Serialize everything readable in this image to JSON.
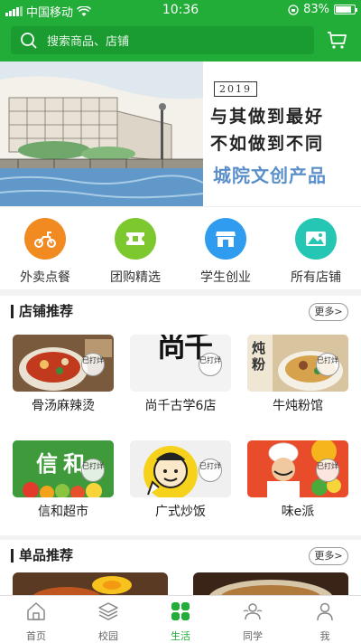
{
  "status_bar": {
    "carrier": "中国移动",
    "time": "10:36",
    "battery": "83%"
  },
  "search": {
    "placeholder": "搜索商品、店铺"
  },
  "banner": {
    "year": "2019",
    "line1": "与其做到最好",
    "line2": "不如做到不同",
    "line3": "城院文创产品"
  },
  "categories": [
    {
      "label": "外卖点餐",
      "color": "#f28a22"
    },
    {
      "label": "团购精选",
      "color": "#7dc82f"
    },
    {
      "label": "学生创业",
      "color": "#2f9cf0"
    },
    {
      "label": "所有店铺",
      "color": "#26c6b4"
    }
  ],
  "shops_section": {
    "title": "店铺推荐",
    "more": "更多>",
    "stamp": "已打烊",
    "items": [
      {
        "name": "骨汤麻辣烫"
      },
      {
        "name": "尚千古学6店"
      },
      {
        "name": "牛炖粉馆"
      },
      {
        "name": "信和超市"
      },
      {
        "name": "广式炒饭"
      },
      {
        "name": "味e派"
      }
    ],
    "thumb_text": {
      "shop2": "尚千",
      "shop3": "炖粉",
      "shop4": "信和"
    }
  },
  "singles_section": {
    "title": "单品推荐",
    "more": "更多>"
  },
  "tabs": [
    {
      "label": "首页",
      "icon": "home-icon",
      "active": false
    },
    {
      "label": "校园",
      "icon": "layers-icon",
      "active": false
    },
    {
      "label": "生活",
      "icon": "grid-icon",
      "active": true
    },
    {
      "label": "同学",
      "icon": "people-icon",
      "active": false
    },
    {
      "label": "我",
      "icon": "person-icon",
      "active": false
    }
  ],
  "colors": {
    "brand_green": "#22ac38"
  }
}
